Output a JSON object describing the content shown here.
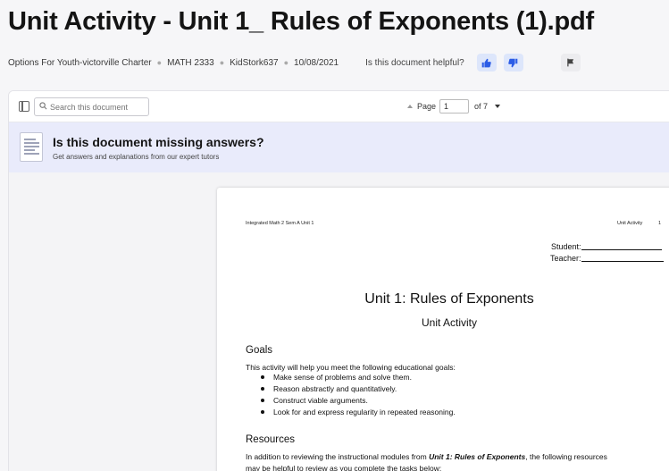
{
  "document": {
    "title": "Unit Activity - Unit 1_ Rules of Exponents (1).pdf",
    "school": "Options For Youth-victorville Charter",
    "course": "MATH 2333",
    "uploader": "KidStork637",
    "date": "10/08/2021",
    "helpful_prompt": "Is this document helpful?"
  },
  "icons": {
    "thumbs_up": "thumbs-up-icon",
    "thumbs_down": "thumbs-down-icon",
    "flag": "flag-icon",
    "sidebar": "sidebar-toggle-icon",
    "search": "search-icon"
  },
  "toolbar": {
    "search_placeholder": "Search this document",
    "page_label": "Page",
    "current_page": "1",
    "page_total": "of 7"
  },
  "banner": {
    "title": "Is this document missing answers?",
    "subtitle": "Get answers and explanations from our expert tutors"
  },
  "page": {
    "header_left": "Integrated Math 2 Sem A Unit 1",
    "header_right": "Unit Activity",
    "header_page": "1",
    "student_label": "Student:",
    "teacher_label": "Teacher:",
    "title": "Unit 1: Rules of Exponents",
    "subtitle": "Unit Activity",
    "goals_heading": "Goals",
    "goals_intro": "This activity will help you meet the following educational goals:",
    "goals": [
      "Make sense of problems and solve them.",
      "Reason abstractly and quantitatively.",
      "Construct viable arguments.",
      "Look for and express regularity in repeated reasoning."
    ],
    "resources_heading": "Resources",
    "resources_text_1": "In addition to reviewing the instructional modules from",
    "resources_emphasis": "Unit 1: Rules of Exponents",
    "resources_text_2": ", the following resources",
    "resources_text_3": "may be helpful to review as you complete the tasks below:"
  },
  "colors": {
    "accent_blue": "#2b5ce6",
    "vote_bg": "#dde6fb",
    "banner_bg": "#e9ebfb"
  }
}
